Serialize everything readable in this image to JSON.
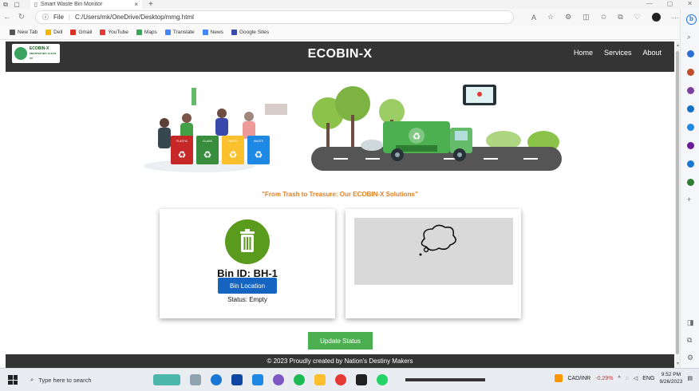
{
  "browser": {
    "tab_title": "Smart Waste Bin Monitor",
    "file_label": "File",
    "url": "C:/Users/mk/OneDrive/Desktop/mmg.html",
    "bookmarks": [
      "New Tab",
      "Dell",
      "Gmail",
      "YouTube",
      "Maps",
      "Translate",
      "News",
      "Google Sites"
    ],
    "bookmark_colors": [
      "#555555",
      "#f5b800",
      "#d93025",
      "#e53935",
      "#34a853",
      "#4285f4",
      "#4285f4",
      "#3949ab"
    ]
  },
  "site": {
    "logo_text": "ECOBIN-X",
    "logo_sub": "SMARTER WAY CLEAN UP",
    "brand": "ECOBIN-X",
    "nav": [
      "Home",
      "Services",
      "About"
    ],
    "bin_labels": [
      "PLASTIC",
      "GLASS",
      "PAPER",
      "WASTE"
    ],
    "tagline": "\"From Trash to Treasure: Our ECOBIN-X Solutions\"",
    "bin_id": "Bin ID: BH-1",
    "location_button": "Bin Location",
    "status": "Status: Empty",
    "update_button": "Update Status",
    "footer": "© 2023 Proudly created by Nation's Destiny Makers"
  },
  "taskbar": {
    "search_placeholder": "Type here to search",
    "ticker_label": "CAD/INR",
    "ticker_change": "-0.29%",
    "language": "ENG",
    "time": "9:52 PM",
    "date": "9/26/2023"
  },
  "colors": {
    "header_bg": "#343434",
    "accent_green": "#4caf50",
    "button_blue": "#1565c0",
    "tagline_orange": "#e67e22",
    "trash_icon_green": "#5a9a1c"
  }
}
